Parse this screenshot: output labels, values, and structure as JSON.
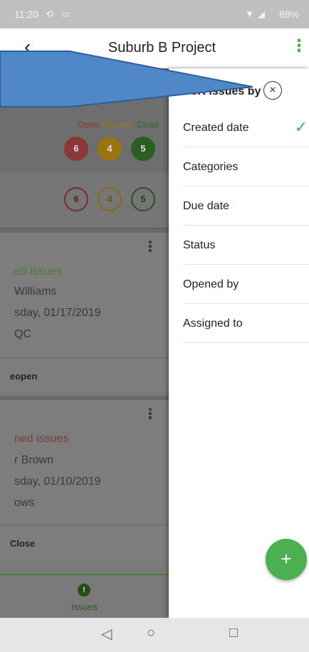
{
  "status_bar": {
    "time": "11:20",
    "battery": "88%"
  },
  "app_bar": {
    "back": "‹",
    "title": "Suburb B Project",
    "menu": "⋮"
  },
  "background": {
    "legend": {
      "open": "Open",
      "resolve": "Resolve",
      "close": "Close"
    },
    "counts": {
      "open": "6",
      "resolve": "4",
      "close": "5"
    },
    "cards": [
      {
        "status": "ed issues",
        "person": "Williams",
        "date": "sday, 01/17/2019",
        "extra": "QC",
        "action": "eopen"
      },
      {
        "status": "ned issues",
        "person": "r Brown",
        "date": "sday, 01/10/2019",
        "extra": "ows",
        "action": "Close"
      }
    ],
    "bottom_nav": {
      "label": "issues",
      "icon": "!"
    }
  },
  "drawer": {
    "title": "Sort issues by",
    "close": "×",
    "options": [
      {
        "label": "Created date",
        "selected": true
      },
      {
        "label": "Categories",
        "selected": false
      },
      {
        "label": "Due date",
        "selected": false
      },
      {
        "label": "Status",
        "selected": false
      },
      {
        "label": "Opened by",
        "selected": false
      },
      {
        "label": "Assigned to",
        "selected": false
      }
    ],
    "check": "✓"
  },
  "fab": {
    "label": "+"
  },
  "system_nav": {
    "back": "◁",
    "home": "○",
    "recent": "□"
  },
  "colors": {
    "accent": "#4caf50",
    "open": "#c94b4b",
    "resolve": "#e0a000",
    "close": "#3a8f2f",
    "annotation": "#4f87c9"
  }
}
